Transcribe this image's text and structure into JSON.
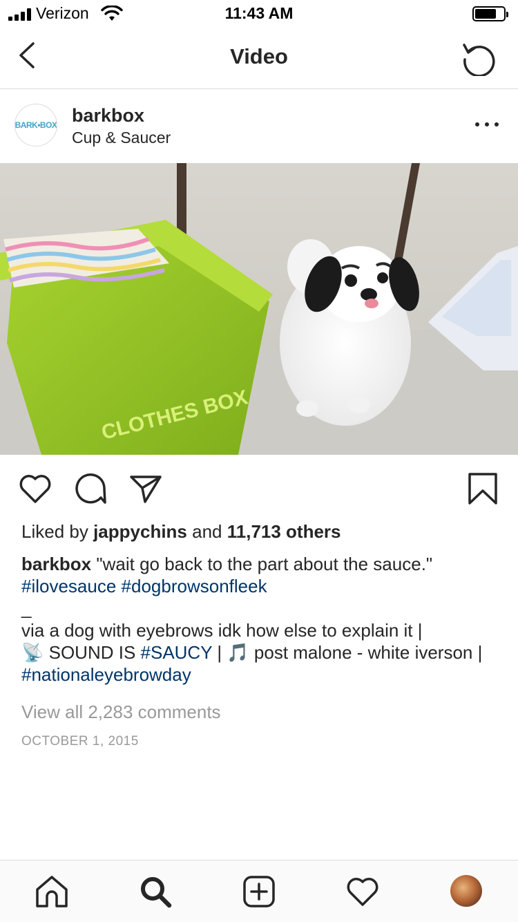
{
  "status_bar": {
    "carrier": "Verizon",
    "time": "11:43 AM",
    "battery_level": 0.76
  },
  "nav": {
    "title": "Video",
    "back_icon": "chevron-left-icon",
    "refresh_icon": "refresh-icon"
  },
  "post": {
    "avatar_text": "BARK•BOX",
    "username": "barkbox",
    "location": "Cup & Saucer",
    "video_box_text": "CLOTHES BOX",
    "likes": {
      "prefix": "Liked by ",
      "user": "jappychins",
      "middle": " and ",
      "others": "11,713 others"
    },
    "caption": {
      "username": "barkbox",
      "text": " \"wait go back to the part about the sauce.\"",
      "tag1": "#ilovesauce",
      "tag2": "#dogbrowsonfleek",
      "separator": "_",
      "line1": "via a dog with eyebrows idk how else to explain it |",
      "satellite_emoji": "📡",
      "sound_text": " SOUND IS ",
      "tag3": "#SAUCY",
      "pipe": " | ",
      "note_emoji": "🎵",
      "music": " post malone - white iverson | ",
      "tag4": "#nationaleyebrowday"
    },
    "comments_link": "View all 2,283 comments",
    "date": "OCTOBER 1, 2015"
  },
  "colors": {
    "hashtag": "#003569",
    "muted": "#999999",
    "divider": "#dbdbdb"
  }
}
